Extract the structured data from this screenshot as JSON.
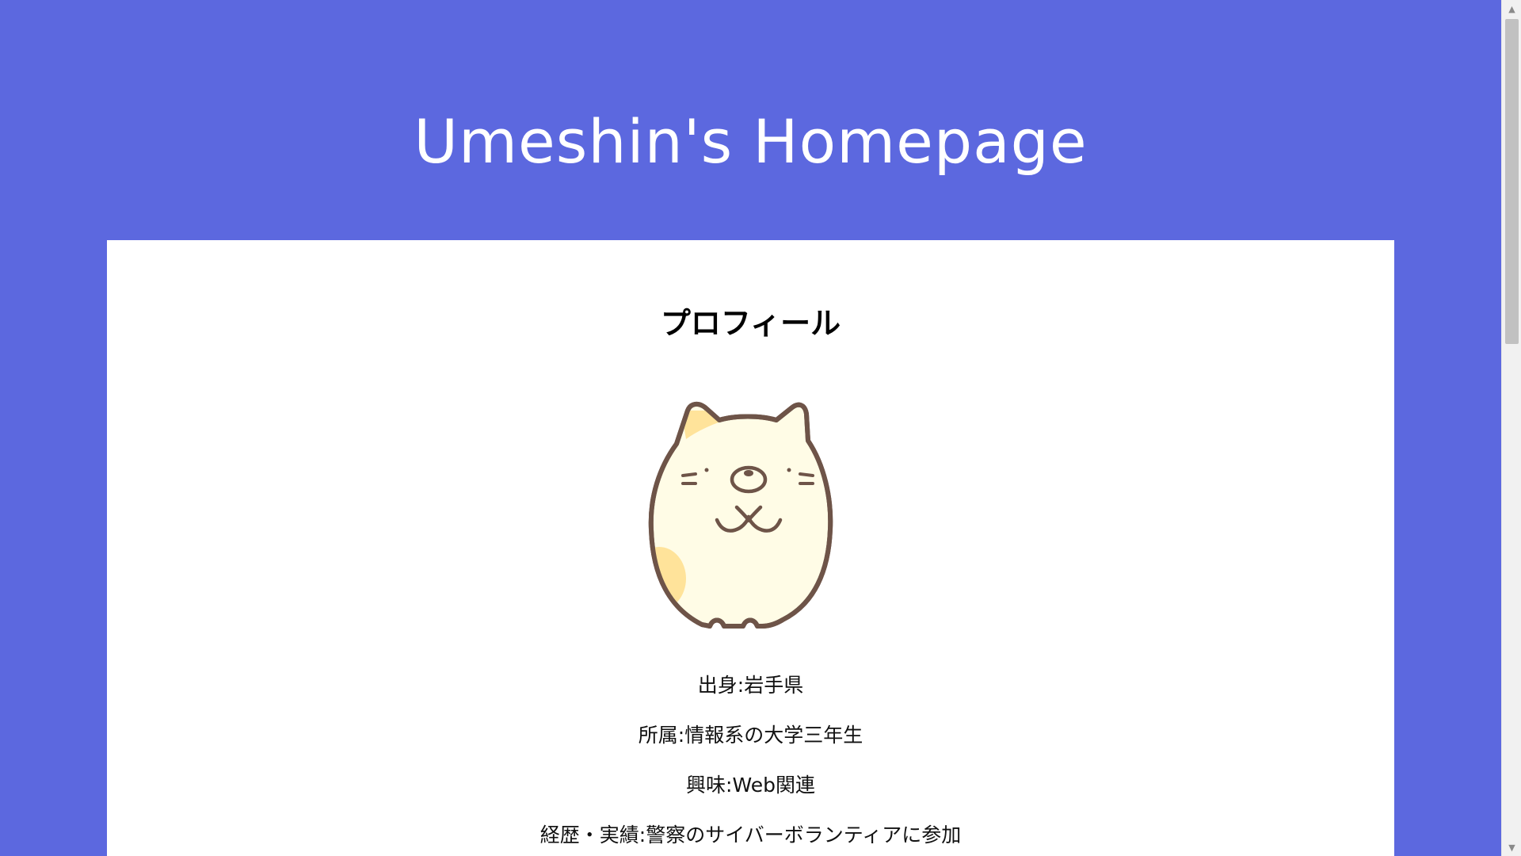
{
  "header": {
    "title": "Umeshin's Homepage"
  },
  "profile": {
    "heading": "プロフィール",
    "avatar_icon": "cat-mascot-illustration",
    "lines": [
      "出身:岩手県",
      "所属:情報系の大学三年生",
      "興味:Web関連",
      "経歴・実績:警察のサイバーボランティアに参加"
    ]
  },
  "scrollbar": {
    "up_icon": "scroll-up-arrow-icon",
    "down_icon": "scroll-down-arrow-icon",
    "up_glyph": "▲",
    "down_glyph": "▼"
  },
  "colors": {
    "page_background": "#5c68df",
    "card_background": "#ffffff",
    "title_text": "#ffffff",
    "avatar_fill": "#fffce6",
    "avatar_outline": "#6e5448",
    "avatar_patch": "#ffe39a"
  }
}
